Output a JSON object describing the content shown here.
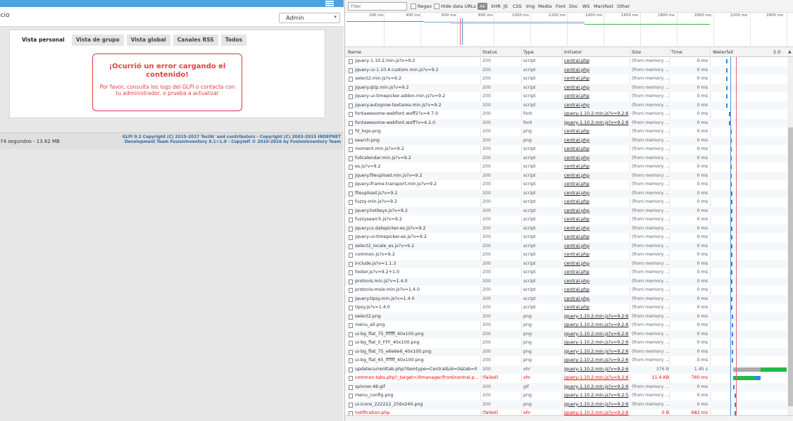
{
  "left": {
    "crumb": "icio",
    "profile_value": "Admin",
    "tabs": [
      "Vista personal",
      "Vista de grupo",
      "Vista global",
      "Canales RSS",
      "Todos"
    ],
    "error_title": "¡Ocurrió un error cargando el contenido!",
    "error_body": "Por favor, consulta los logs del GLPI o contacta con tu administrador. o prueba a actualizar",
    "footer_time": "74 segundos - 13.62 MB",
    "footer_copy": "GLPI 9.2 Copyright (C) 2015-2017 Teclib' and contributors - Copyright (C) 2003-2015 INDEPNET Development Team FusionInventory 9.1+1.0 - Copyleft © 2010-2016 by FusionInventory Team"
  },
  "devtools": {
    "filter_placeholder": "Filter",
    "regex_label": "Regex",
    "hide_urls_label": "Hide data URLs",
    "type_filters": [
      "All",
      "XHR",
      "JS",
      "CSS",
      "Img",
      "Media",
      "Font",
      "Doc",
      "WS",
      "Manifest",
      "Other"
    ],
    "ticks": [
      "200 ms",
      "400 ms",
      "600 ms",
      "800 ms",
      "1000 ms",
      "1200 ms",
      "1400 ms",
      "1600 ms",
      "1800 ms",
      "2000 ms",
      "2200 ms",
      "2400 ms"
    ],
    "columns": {
      "name": "Name",
      "status": "Status",
      "type": "Type",
      "initiator": "Initiator",
      "size": "Size",
      "time": "Time",
      "waterfall": "Waterfall",
      "waterfall_right": "2.0"
    },
    "rows": [
      {
        "name": "jquery-1.10.2.min.js?v=9.2",
        "status": "200",
        "type": "script",
        "initiator": "central.php",
        "size": "(from memory ...",
        "time": "0 ms"
      },
      {
        "name": "jquery-ui-1.10.4.custom.min.js?v=9.2",
        "status": "200",
        "type": "script",
        "initiator": "central.php",
        "size": "(from memory ...",
        "time": "0 ms"
      },
      {
        "name": "select2.min.js?v=9.2",
        "status": "200",
        "type": "script",
        "initiator": "central.php",
        "size": "(from memory ...",
        "time": "0 ms"
      },
      {
        "name": "jquery.qtip.min.js?v=9.2",
        "status": "200",
        "type": "script",
        "initiator": "central.php",
        "size": "(from memory ...",
        "time": "0 ms"
      },
      {
        "name": "jquery-ui-timepicker-addon.min.js?v=9.2",
        "status": "200",
        "type": "script",
        "initiator": "central.php",
        "size": "(from memory ...",
        "time": "0 ms"
      },
      {
        "name": "jquery.autogrow-textarea.min.js?v=9.2",
        "status": "200",
        "type": "script",
        "initiator": "central.php",
        "size": "(from memory ...",
        "time": "0 ms"
      },
      {
        "name": "fontawesome-webfont.woff2?v=4.7.0",
        "status": "200",
        "type": "font",
        "initiator": "jquery-1.10.2.min.js?v=9.2:6",
        "size": "(from memory ...",
        "time": "0 ms"
      },
      {
        "name": "fontawesome-webfont.woff?v=4.2.0",
        "status": "200",
        "type": "font",
        "initiator": "jquery-1.10.2.min.js?v=9.2:6",
        "size": "(from memory ...",
        "time": "0 ms"
      },
      {
        "name": "fd_logo.png",
        "status": "200",
        "type": "png",
        "initiator": "central.php",
        "size": "(from memory ...",
        "time": "0 ms"
      },
      {
        "name": "search.png",
        "status": "200",
        "type": "png",
        "initiator": "central.php",
        "size": "(from memory ...",
        "time": "0 ms"
      },
      {
        "name": "moment.min.js?v=9.2",
        "status": "200",
        "type": "script",
        "initiator": "central.php",
        "size": "(from memory ...",
        "time": "0 ms"
      },
      {
        "name": "fullcalendar.min.js?v=9.2",
        "status": "200",
        "type": "script",
        "initiator": "central.php",
        "size": "(from memory ...",
        "time": "0 ms"
      },
      {
        "name": "es.js?v=9.2",
        "status": "200",
        "type": "script",
        "initiator": "central.php",
        "size": "(from memory ...",
        "time": "0 ms"
      },
      {
        "name": "jquery.fileupload.min.js?v=9.2",
        "status": "200",
        "type": "script",
        "initiator": "central.php",
        "size": "(from memory ...",
        "time": "0 ms"
      },
      {
        "name": "jquery.iframe-transport.min.js?v=9.2",
        "status": "200",
        "type": "script",
        "initiator": "central.php",
        "size": "(from memory ...",
        "time": "0 ms"
      },
      {
        "name": "fileupload.js?v=9.2",
        "status": "200",
        "type": "script",
        "initiator": "central.php",
        "size": "(from memory ...",
        "time": "0 ms"
      },
      {
        "name": "fuzzy-min.js?v=9.2",
        "status": "200",
        "type": "script",
        "initiator": "central.php",
        "size": "(from memory ...",
        "time": "0 ms"
      },
      {
        "name": "jquery.hotkeys.js?v=9.2",
        "status": "200",
        "type": "script",
        "initiator": "central.php",
        "size": "(from memory ...",
        "time": "0 ms"
      },
      {
        "name": "fuzzysearch.js?v=9.2",
        "status": "200",
        "type": "script",
        "initiator": "central.php",
        "size": "(from memory ...",
        "time": "0 ms"
      },
      {
        "name": "jquery.ui.datepicker-es.js?v=9.2",
        "status": "200",
        "type": "script",
        "initiator": "central.php",
        "size": "(from memory ...",
        "time": "0 ms"
      },
      {
        "name": "jquery-ui-timepicker-es.js?v=9.2",
        "status": "200",
        "type": "script",
        "initiator": "central.php",
        "size": "(from memory ...",
        "time": "0 ms"
      },
      {
        "name": "select2_locale_es.js?v=9.2",
        "status": "200",
        "type": "script",
        "initiator": "central.php",
        "size": "(from memory ...",
        "time": "0 ms"
      },
      {
        "name": "common.js?v=9.2",
        "status": "200",
        "type": "script",
        "initiator": "central.php",
        "size": "(from memory ...",
        "time": "0 ms"
      },
      {
        "name": "include.js?v=1.1.3",
        "status": "200",
        "type": "script",
        "initiator": "central.php",
        "size": "(from memory ...",
        "time": "0 ms"
      },
      {
        "name": "footer.js?v=9.2+1.0",
        "status": "200",
        "type": "script",
        "initiator": "central.php",
        "size": "(from memory ...",
        "time": "0 ms"
      },
      {
        "name": "protovis.min.js?v=1.4.0",
        "status": "200",
        "type": "script",
        "initiator": "central.php",
        "size": "(from memory ...",
        "time": "0 ms"
      },
      {
        "name": "protovis-msie.min.js?v=1.4.0",
        "status": "200",
        "type": "script",
        "initiator": "central.php",
        "size": "(from memory ...",
        "time": "0 ms"
      },
      {
        "name": "jquery.tipsy.min.js?v=1.4.0",
        "status": "200",
        "type": "script",
        "initiator": "central.php",
        "size": "(from memory ...",
        "time": "0 ms"
      },
      {
        "name": "tipsy.js?v=1.4.0",
        "status": "200",
        "type": "script",
        "initiator": "central.php",
        "size": "(from memory ...",
        "time": "0 ms"
      },
      {
        "name": "select2.png",
        "status": "200",
        "type": "png",
        "initiator": "jquery-1.10.2.min.js?v=9.2:6",
        "size": "(from memory ...",
        "time": "0 ms"
      },
      {
        "name": "menu_all.png",
        "status": "200",
        "type": "png",
        "initiator": "jquery-1.10.2.min.js?v=9.2:6",
        "size": "(from memory ...",
        "time": "0 ms"
      },
      {
        "name": "ui-bg_flat_75_ffffff_40x100.png",
        "status": "200",
        "type": "png",
        "initiator": "jquery-1.10.2.min.js?v=9.2:6",
        "size": "(from memory ...",
        "time": "0 ms"
      },
      {
        "name": "ui-bg_flat_0_FFF_40x100.png",
        "status": "200",
        "type": "png",
        "initiator": "jquery-1.10.2.min.js?v=9.2:6",
        "size": "(from memory ...",
        "time": "0 ms"
      },
      {
        "name": "ui-bg_flat_75_e6e6e6_40x100.png",
        "status": "200",
        "type": "png",
        "initiator": "jquery-1.10.2.min.js?v=9.2:6",
        "size": "(from memory ...",
        "time": "0 ms"
      },
      {
        "name": "ui-bg_flat_65_ffffff_40x100.png",
        "status": "200",
        "type": "png",
        "initiator": "jquery-1.10.2.min.js?v=9.2:6",
        "size": "(from memory ...",
        "time": "0 ms"
      },
      {
        "name": "updatecurrenttab.php?itemtype=Central&id=0&tab=0",
        "status": "200",
        "type": "xhr",
        "initiator": "jquery-1.10.2.min.js?v=9.2:6",
        "size": "376 B",
        "time": "1.45 s"
      },
      {
        "name": "common.tabs.php?_target=/itmanager/front/central.p...",
        "status": "(failed)",
        "type": "xhr",
        "initiator": "jquery-1.10.2.min.js?v=9.2:6",
        "size": "11.4 KB",
        "time": "760 ms"
      },
      {
        "name": "spinner.48.gif",
        "status": "200",
        "type": "gif",
        "initiator": "jquery-1.10.2.min.js?v=9.2:6",
        "size": "(from memory ...",
        "time": "0 ms"
      },
      {
        "name": "menu_config.png",
        "status": "200",
        "type": "png",
        "initiator": "jquery-1.10.2.min.js?v=9.2:5",
        "size": "(from memory ...",
        "time": "0 ms"
      },
      {
        "name": "ui-icons_222222_256x240.png",
        "status": "200",
        "type": "png",
        "initiator": "jquery-1.10.2.min.js?v=9.2:6",
        "size": "(from memory ...",
        "time": "0 ms"
      },
      {
        "name": "notification.php",
        "status": "(failed)",
        "type": "xhr",
        "initiator": "jquery-1.10.2.min.js?v=9.2:6",
        "size": "0 B",
        "time": "682 ms"
      }
    ]
  }
}
